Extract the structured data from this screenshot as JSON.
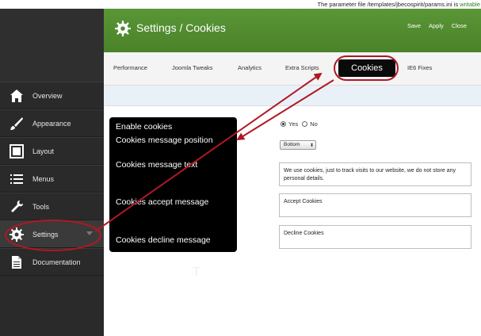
{
  "notice": {
    "prefix": "The parameter file /templates/jbecospirit/params.ini is ",
    "status": "writable"
  },
  "sidebar": {
    "items": [
      {
        "label": "Overview",
        "icon": "home-icon"
      },
      {
        "label": "Appearance",
        "icon": "brush-icon"
      },
      {
        "label": "Layout",
        "icon": "layout-icon"
      },
      {
        "label": "Menus",
        "icon": "list-icon"
      },
      {
        "label": "Tools",
        "icon": "wrench-icon"
      },
      {
        "label": "Settings",
        "icon": "gear-icon"
      },
      {
        "label": "Documentation",
        "icon": "document-icon"
      }
    ]
  },
  "header": {
    "title": "Settings / Cookies",
    "save": "Save",
    "apply": "Apply",
    "close": "Close"
  },
  "tabs": [
    "Performance",
    "Joomla Tweaks",
    "Analytics",
    "Extra Scripts",
    "Cookies",
    "IE6 Fixes"
  ],
  "callout": {
    "enable": "Enable cookies",
    "position": "Cookies message position",
    "text": "Cookies message text",
    "accept": "Cookies accept message",
    "decline": "Cookies decline message"
  },
  "form": {
    "yes": "Yes",
    "no": "No",
    "enabled": "Yes",
    "position_value": "Bottom",
    "message_text": "We use cookies, just to track visits to our website, we do not store any personal details.",
    "accept_text": "Accept Cookies",
    "decline_text": "Decline Cookies"
  },
  "colors": {
    "header_green": "#4f8a2e",
    "annotation_red": "#b01823",
    "sidebar_bg": "#2a2a2a",
    "writable_green": "#2e7d1f"
  }
}
